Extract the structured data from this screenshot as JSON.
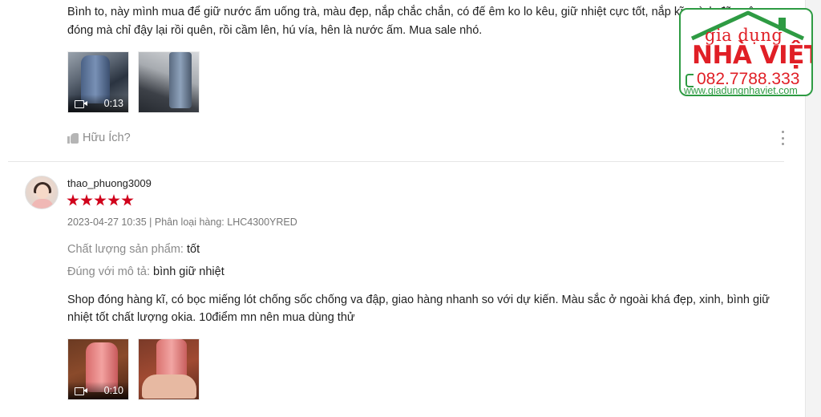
{
  "review1": {
    "text": "Bình to, này mình mua để giữ nước ấm uống trà, màu đẹp, nắp chắc chắn, có đế êm ko lo kêu, giữ nhiệt cực tốt, nắp kĩ, mình đã quên đóng mà chỉ đậy lại rồi quên, rồi cầm lên, hú vía, hên là nước ấm. Mua sale nhó.",
    "video_duration": "0:13",
    "helpful_label": "Hữu Ích?"
  },
  "review2": {
    "username": "thao_phuong3009",
    "rating": 5,
    "meta": "2023-04-27 10:35 | Phân loại hàng: LHC4300YRED",
    "quality_label": "Chất lượng sản phẩm:",
    "quality_value": "tốt",
    "desc_label": "Đúng với mô tả:",
    "desc_value": "bình giữ nhiệt",
    "text": "Shop đóng hàng kĩ, có bọc miếng lót chống sốc chống va đập, giao hàng nhanh so với dự kiến. Màu sắc ở ngoài khá đẹp, xinh, bình giữ nhiệt tốt chất lượng okia. 10điểm mn nên mua dùng thử",
    "video_duration": "0:10"
  },
  "watermark": {
    "line1": "gia dụng",
    "line2": "NHÀ VIỆT",
    "phone": "082.7788.333",
    "website": "www.giadungnhaviet.com"
  },
  "colors": {
    "star": "#d0011b",
    "logo_red": "#e01f26",
    "logo_green": "#2e9b43"
  },
  "icons": [
    "video-camera-icon",
    "thumbs-up-icon",
    "more-vertical-icon",
    "star-icon",
    "phone-icon"
  ]
}
